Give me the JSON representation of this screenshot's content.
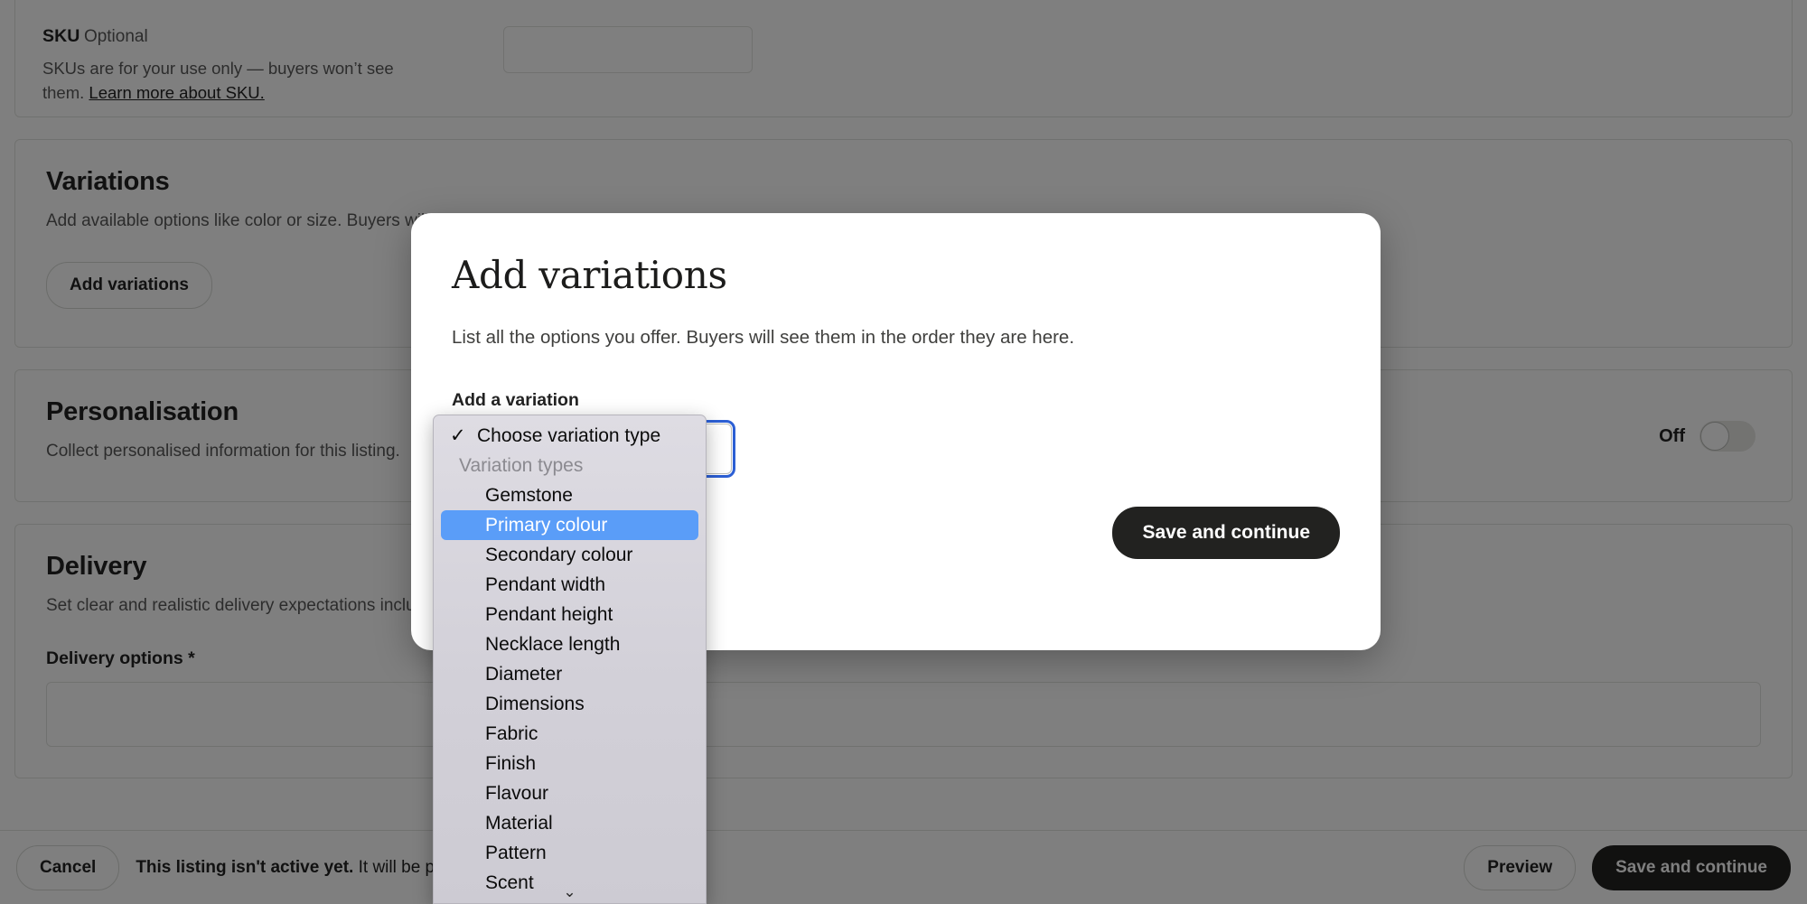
{
  "page": {
    "sku": {
      "label": "SKU",
      "optional": "Optional",
      "helper_prefix": "SKUs are for your use only — buyers won’t see them. ",
      "helper_link": "Learn more about SKU.",
      "input_value": "",
      "input_placeholder": ""
    },
    "variations": {
      "title": "Variations",
      "subtitle": "Add available options like color or size. Buyers will choose from them.",
      "button": "Add variations"
    },
    "personalisation": {
      "title": "Personalisation",
      "subtitle": "Collect personalised information for this listing.",
      "toggle_label": "Off",
      "toggle_state": "off"
    },
    "delivery": {
      "title": "Delivery",
      "subtitle": "Set clear and realistic delivery expectations including an accurate processing time.",
      "field_label": "Delivery options *"
    }
  },
  "bottombar": {
    "cancel": "Cancel",
    "alert_bold": "This listing isn't active yet.",
    "alert_rest": " It will be published when you open your shop.",
    "preview": "Preview",
    "save_and_continue": "Save and continue"
  },
  "modal": {
    "title": "Add variations",
    "subtitle": "List all the options you offer. Buyers will see them in the order they are here.",
    "field_label": "Add a variation",
    "select_value": "Choose variation type",
    "save_button": "Save and continue"
  },
  "select_popup": {
    "checked_item": "Choose variation type",
    "group_label": "Variation types",
    "selected_item": "Primary colour",
    "scroll_indicator": "⌄",
    "options": [
      "Gemstone",
      "Primary colour",
      "Secondary colour",
      "Pendant width",
      "Pendant height",
      "Necklace length",
      "Diameter",
      "Dimensions",
      "Fabric",
      "Finish",
      "Flavour",
      "Material",
      "Pattern",
      "Scent"
    ]
  },
  "colors": {
    "accent_highlight": "#5a9df8",
    "focus_ring": "#2c5fd4",
    "dark_button": "#222220",
    "overlay": "rgba(0,0,0,0.5)"
  }
}
